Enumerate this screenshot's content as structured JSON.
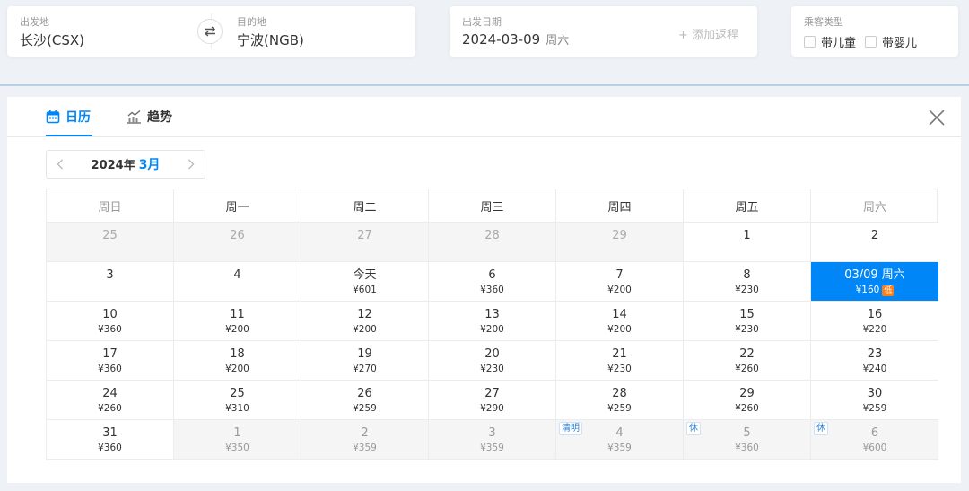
{
  "search": {
    "departure": {
      "label": "出发地",
      "value": "长沙(CSX)"
    },
    "arrival": {
      "label": "目的地",
      "value": "宁波(NGB)"
    },
    "date": {
      "label": "出发日期",
      "value": "2024-03-09",
      "weekday": "周六",
      "add_return": "+ 添加返程"
    },
    "passenger": {
      "label": "乘客类型",
      "child": "带儿童",
      "infant": "带婴儿"
    }
  },
  "panel": {
    "tabs": [
      {
        "label": "日历"
      },
      {
        "label": "趋势"
      }
    ],
    "month_nav": {
      "year": "2024年",
      "month": "3月"
    }
  },
  "calendar": {
    "weekdays": [
      "周日",
      "周一",
      "周二",
      "周三",
      "周四",
      "周五",
      "周六"
    ],
    "cells": [
      {
        "day": "25",
        "price": "",
        "state": "disabled",
        "tag": ""
      },
      {
        "day": "26",
        "price": "",
        "state": "disabled",
        "tag": ""
      },
      {
        "day": "27",
        "price": "",
        "state": "disabled",
        "tag": ""
      },
      {
        "day": "28",
        "price": "",
        "state": "disabled",
        "tag": ""
      },
      {
        "day": "29",
        "price": "",
        "state": "disabled",
        "tag": ""
      },
      {
        "day": "1",
        "price": "",
        "state": "normal",
        "tag": ""
      },
      {
        "day": "2",
        "price": "",
        "state": "normal",
        "tag": ""
      },
      {
        "day": "3",
        "price": "",
        "state": "normal",
        "tag": ""
      },
      {
        "day": "4",
        "price": "",
        "state": "normal",
        "tag": ""
      },
      {
        "day": "今天",
        "price": "¥601",
        "state": "normal",
        "tag": ""
      },
      {
        "day": "6",
        "price": "¥360",
        "state": "normal",
        "tag": ""
      },
      {
        "day": "7",
        "price": "¥200",
        "state": "normal",
        "tag": ""
      },
      {
        "day": "8",
        "price": "¥230",
        "state": "normal",
        "tag": ""
      },
      {
        "day": "03/09 周六",
        "price": "¥160",
        "state": "selected",
        "tag": "",
        "badge": "低"
      },
      {
        "day": "10",
        "price": "¥360",
        "state": "normal",
        "tag": ""
      },
      {
        "day": "11",
        "price": "¥200",
        "state": "normal",
        "tag": ""
      },
      {
        "day": "12",
        "price": "¥200",
        "state": "normal",
        "tag": ""
      },
      {
        "day": "13",
        "price": "¥200",
        "state": "normal",
        "tag": ""
      },
      {
        "day": "14",
        "price": "¥200",
        "state": "normal",
        "tag": ""
      },
      {
        "day": "15",
        "price": "¥230",
        "state": "normal",
        "tag": ""
      },
      {
        "day": "16",
        "price": "¥220",
        "state": "normal",
        "tag": ""
      },
      {
        "day": "17",
        "price": "¥360",
        "state": "normal",
        "tag": ""
      },
      {
        "day": "18",
        "price": "¥200",
        "state": "normal",
        "tag": ""
      },
      {
        "day": "19",
        "price": "¥270",
        "state": "normal",
        "tag": ""
      },
      {
        "day": "20",
        "price": "¥230",
        "state": "normal",
        "tag": ""
      },
      {
        "day": "21",
        "price": "¥230",
        "state": "normal",
        "tag": ""
      },
      {
        "day": "22",
        "price": "¥260",
        "state": "normal",
        "tag": ""
      },
      {
        "day": "23",
        "price": "¥240",
        "state": "normal",
        "tag": ""
      },
      {
        "day": "24",
        "price": "¥260",
        "state": "normal",
        "tag": ""
      },
      {
        "day": "25",
        "price": "¥310",
        "state": "normal",
        "tag": ""
      },
      {
        "day": "26",
        "price": "¥259",
        "state": "normal",
        "tag": ""
      },
      {
        "day": "27",
        "price": "¥290",
        "state": "normal",
        "tag": ""
      },
      {
        "day": "28",
        "price": "¥259",
        "state": "normal",
        "tag": ""
      },
      {
        "day": "29",
        "price": "¥260",
        "state": "normal",
        "tag": ""
      },
      {
        "day": "30",
        "price": "¥259",
        "state": "normal",
        "tag": ""
      },
      {
        "day": "31",
        "price": "¥360",
        "state": "normal",
        "tag": ""
      },
      {
        "day": "1",
        "price": "¥350",
        "state": "future",
        "tag": ""
      },
      {
        "day": "2",
        "price": "¥359",
        "state": "future",
        "tag": ""
      },
      {
        "day": "3",
        "price": "¥359",
        "state": "future",
        "tag": ""
      },
      {
        "day": "4",
        "price": "¥359",
        "state": "future",
        "tag": "清明"
      },
      {
        "day": "5",
        "price": "¥360",
        "state": "future",
        "tag": "休"
      },
      {
        "day": "6",
        "price": "¥600",
        "state": "future",
        "tag": "休"
      }
    ]
  },
  "colors": {
    "accent": "#0086f6",
    "low_badge": "#ff7d13",
    "tag_text": "#2a7fd4"
  }
}
